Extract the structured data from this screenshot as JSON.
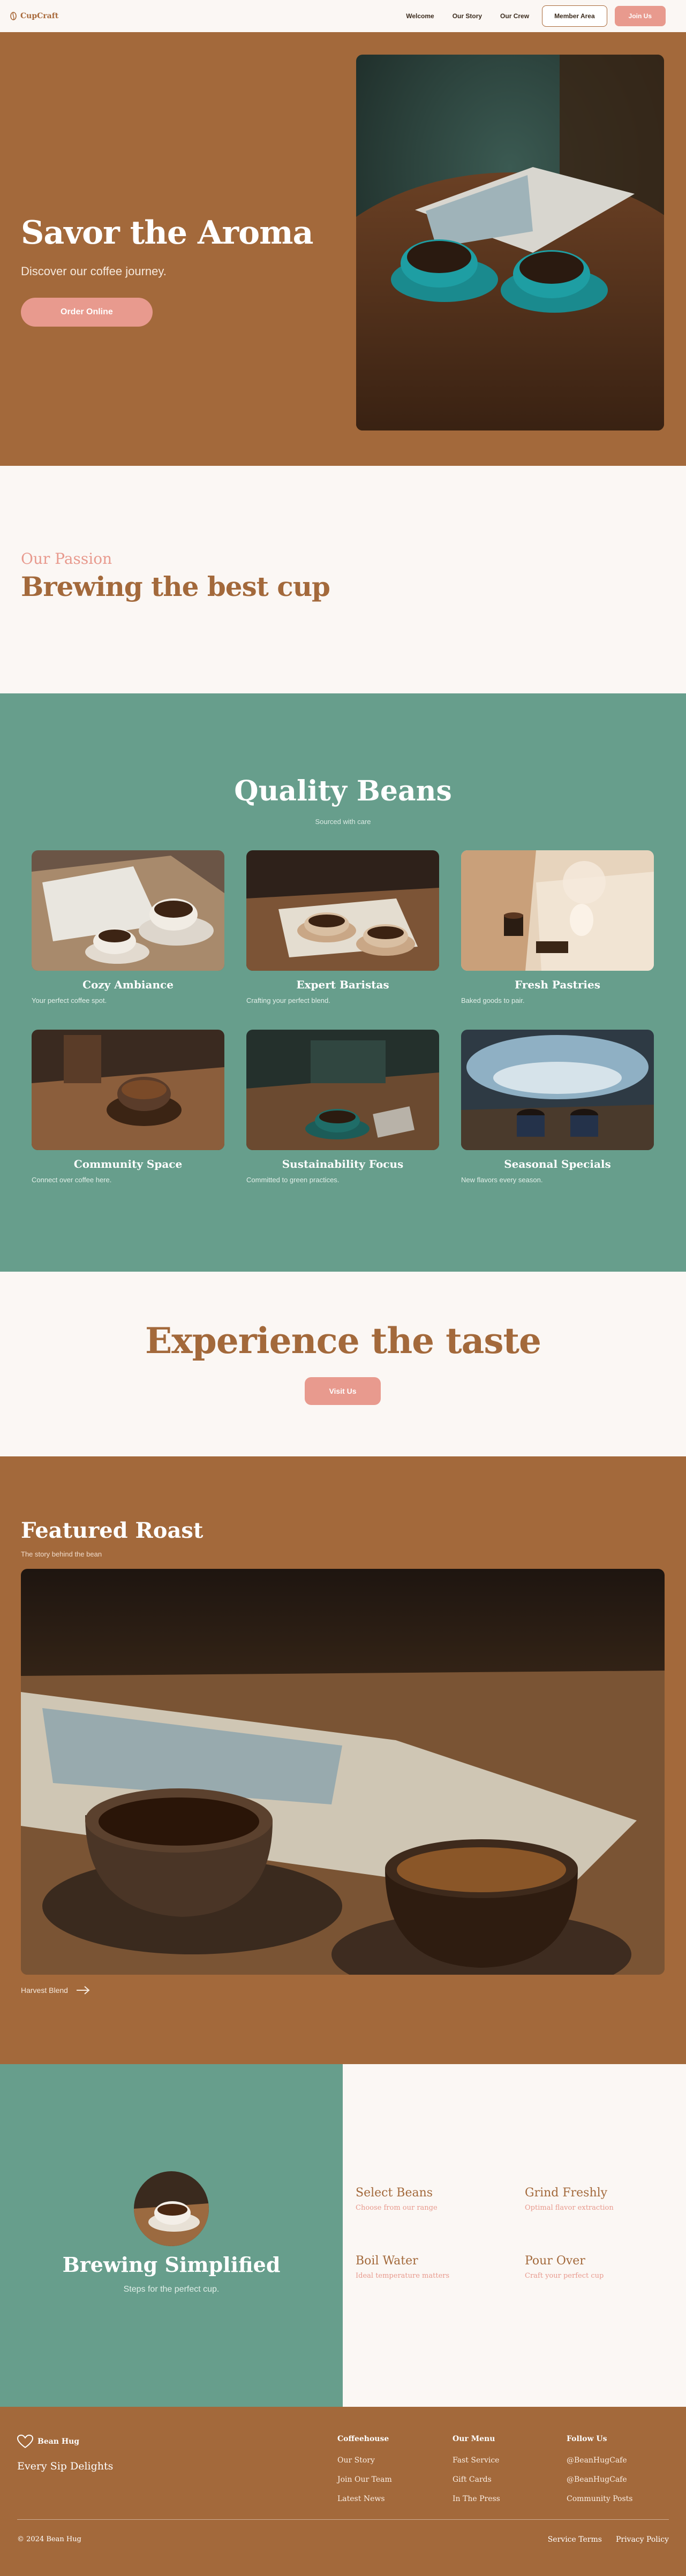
{
  "brand": {
    "name": "CupCraft",
    "logo_icon": "coffee-bean-icon"
  },
  "nav": {
    "links": [
      "Welcome",
      "Our Story",
      "Our Crew"
    ],
    "member_label": "Member Area",
    "join_label": "Join Us"
  },
  "hero": {
    "title": "Savor the Aroma",
    "subtitle": "Discover our coffee journey.",
    "cta": "Order Online"
  },
  "passion": {
    "eyebrow": "Our Passion",
    "title": "Brewing the best cup"
  },
  "quality": {
    "title": "Quality Beans",
    "subtitle": "Sourced with care",
    "cards": [
      {
        "title": "Cozy Ambiance",
        "desc": "Your perfect coffee spot."
      },
      {
        "title": "Expert Baristas",
        "desc": "Crafting your perfect blend."
      },
      {
        "title": "Fresh Pastries",
        "desc": "Baked goods to pair."
      },
      {
        "title": "Community Space",
        "desc": "Connect over coffee here."
      },
      {
        "title": "Sustainability Focus",
        "desc": "Committed to green practices."
      },
      {
        "title": "Seasonal Specials",
        "desc": "New flavors every season."
      }
    ]
  },
  "experience": {
    "title": "Experience the taste",
    "cta": "Visit Us"
  },
  "featured": {
    "title": "Featured Roast",
    "subtitle": "The story behind the bean",
    "link": "Harvest Blend"
  },
  "brewing": {
    "title": "Brewing Simplified",
    "subtitle": "Steps for the perfect cup.",
    "steps": [
      {
        "title": "Select Beans",
        "desc": "Choose from our range"
      },
      {
        "title": "Grind Freshly",
        "desc": "Optimal flavor extraction"
      },
      {
        "title": "Boil Water",
        "desc": "Ideal temperature matters"
      },
      {
        "title": "Pour Over",
        "desc": "Craft your perfect cup"
      }
    ]
  },
  "footer": {
    "brand": "Bean Hug",
    "tagline": "Every Sip Delights",
    "columns": [
      {
        "title": "Coffeehouse",
        "items": [
          "Our Story",
          "Join Our Team",
          "Latest News"
        ]
      },
      {
        "title": "Our Menu",
        "items": [
          "Fast Service",
          "Gift Cards",
          "In The Press"
        ]
      },
      {
        "title": "Follow Us",
        "items": [
          "@BeanHugCafe",
          "@BeanHugCafe",
          "Community Posts"
        ]
      }
    ],
    "copyright": "© 2024 Bean Hug",
    "legal": [
      "Service Terms",
      "Privacy Policy"
    ]
  },
  "colors": {
    "brown": "#a3693b",
    "teal": "#679e8c",
    "pink": "#e89a8e",
    "cream": "#fbf7f4"
  }
}
